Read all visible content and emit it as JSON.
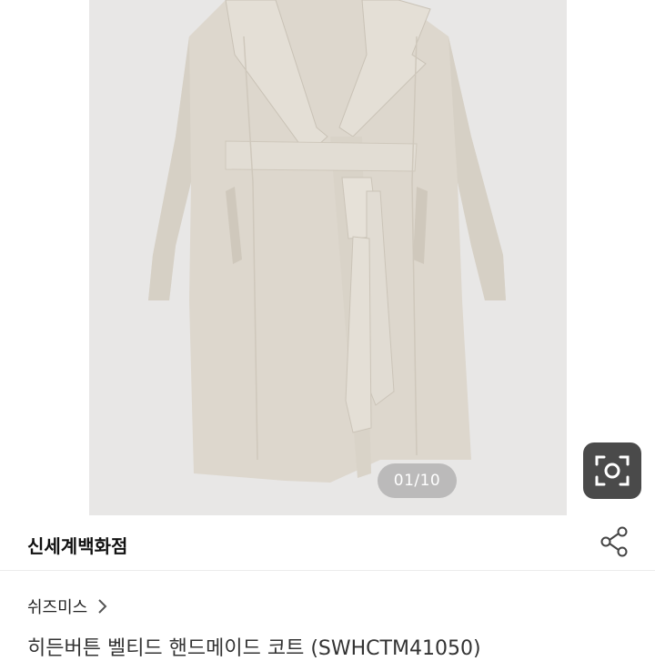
{
  "gallery": {
    "image": "beige-belted-wrap-coat",
    "counter": "01/10",
    "lens_icon": "camera-scan-icon",
    "background_color": "#e8e7e6",
    "coat_color": "#ddd7cd"
  },
  "store": {
    "name": "신세계백화점",
    "share_icon": "share-icon"
  },
  "product": {
    "brand": "쉬즈미스",
    "brand_chevron_icon": "chevron-right-icon",
    "title": "히든버튼 벨티드 핸드메이드 코트 (SWHCTM41050)"
  }
}
